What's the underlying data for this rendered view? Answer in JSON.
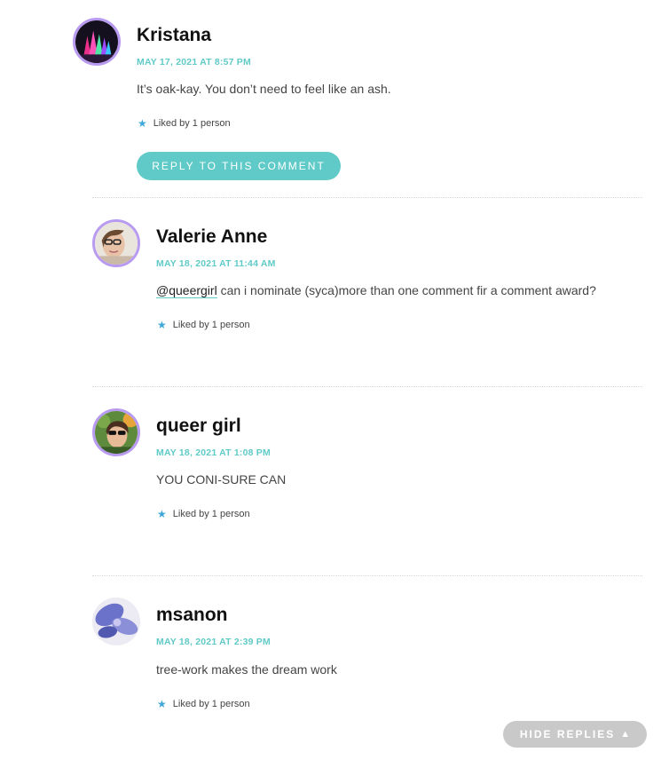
{
  "comments": [
    {
      "author": "Kristana",
      "date": "MAY 17, 2021 AT 8:57 PM",
      "text": "It’s oak-kay. You don’t need to feel like an ash.",
      "likes": "Liked by 1 person",
      "avatar_icon": "crystals-avatar"
    },
    {
      "author": "Valerie Anne",
      "date": "MAY 18, 2021 AT 11:44 AM",
      "mention": "@queergirl",
      "text": " can i nominate (syca)more than one comment fir a comment award?",
      "likes": "Liked by 1 person",
      "avatar_icon": "person-glasses-avatar"
    },
    {
      "author": "queer girl",
      "date": "MAY 18, 2021 AT 1:08 PM",
      "text": "YOU CONI-SURE CAN",
      "likes": "Liked by 1 person",
      "avatar_icon": "person-sunglasses-avatar"
    },
    {
      "author": "msanon",
      "date": "MAY 18, 2021 AT 2:39 PM",
      "text": "tree-work makes the dream work",
      "likes": "Liked by 1 person",
      "avatar_icon": "blue-flower-avatar"
    }
  ],
  "reply_button": "REPLY TO THIS COMMENT",
  "hide_replies": "HIDE REPLIES",
  "icons": {
    "like": "star-icon",
    "hide": "triangle-up-icon"
  },
  "colors": {
    "accent": "#5fcac7",
    "avatar_ring": "#b89af0",
    "star": "#3ea7d8",
    "hide_button": "#c9c9c9"
  }
}
